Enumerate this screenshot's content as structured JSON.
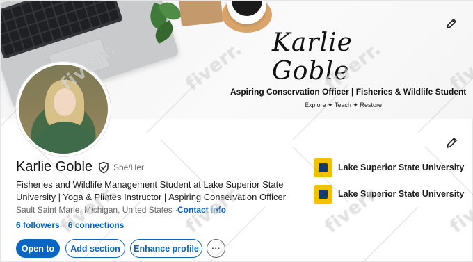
{
  "banner": {
    "signature": "Karlie Goble",
    "tagline": "Aspiring Conservation Officer | Fisheries & Wildlife Student",
    "subtagline": "Explore ✦ Teach ✦ Restore"
  },
  "profile": {
    "name": "Karlie Goble",
    "pronouns": "She/Her",
    "headline": "Fisheries and Wildlife Management Student at Lake Superior State University | Yoga & Pilates Instructor | Aspiring Conservation Officer",
    "location": "Sault Saint Marie, Michigan, United States",
    "contact_label": "Contact info",
    "followers": "6 followers",
    "connections": "6 connections"
  },
  "actions": {
    "open_to": "Open to",
    "add_section": "Add section",
    "enhance_profile": "Enhance profile",
    "more": "···"
  },
  "organizations": [
    {
      "label": "Lake Superior State University"
    },
    {
      "label": "Lake Superior State University"
    }
  ],
  "watermark": "fiverr.",
  "colors": {
    "accent": "#0a66c2",
    "org_logo": "#f2c200"
  },
  "icons": {
    "edit": "pencil-icon",
    "verify": "shield-check-icon",
    "more": "ellipsis-icon"
  }
}
